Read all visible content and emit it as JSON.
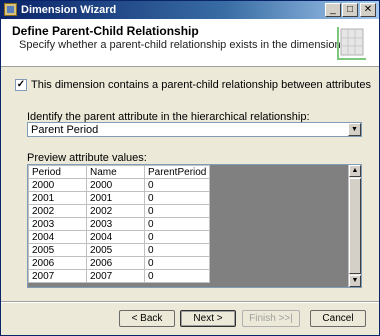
{
  "window": {
    "title": "Dimension Wizard",
    "min_glyph": "_",
    "max_glyph": "□",
    "close_glyph": "✕"
  },
  "header": {
    "title": "Define Parent-Child Relationship",
    "subtitle": "Specify whether a parent-child relationship exists in the dimension."
  },
  "checkbox": {
    "checked": true,
    "mark": "✓",
    "label": "This dimension contains a parent-child relationship between attributes"
  },
  "parent_attr": {
    "label": "Identify the parent attribute in the hierarchical relationship:",
    "value": "Parent Period",
    "arrow": "▼"
  },
  "preview": {
    "label": "Preview attribute values:",
    "columns": [
      "Period",
      "Name",
      "ParentPeriod"
    ],
    "rows": [
      [
        "2000",
        "2000",
        "0"
      ],
      [
        "2001",
        "2001",
        "0"
      ],
      [
        "2002",
        "2002",
        "0"
      ],
      [
        "2003",
        "2003",
        "0"
      ],
      [
        "2004",
        "2004",
        "0"
      ],
      [
        "2005",
        "2005",
        "0"
      ],
      [
        "2006",
        "2006",
        "0"
      ],
      [
        "2007",
        "2007",
        "0"
      ]
    ],
    "scroll_up": "▲",
    "scroll_down": "▼"
  },
  "buttons": {
    "back": "< Back",
    "next": "Next >",
    "finish": "Finish >>|",
    "cancel": "Cancel"
  },
  "colors": {
    "titlebar": "#0a246a",
    "dialog_bg": "#ece9d8",
    "grid_bg": "#808080"
  }
}
